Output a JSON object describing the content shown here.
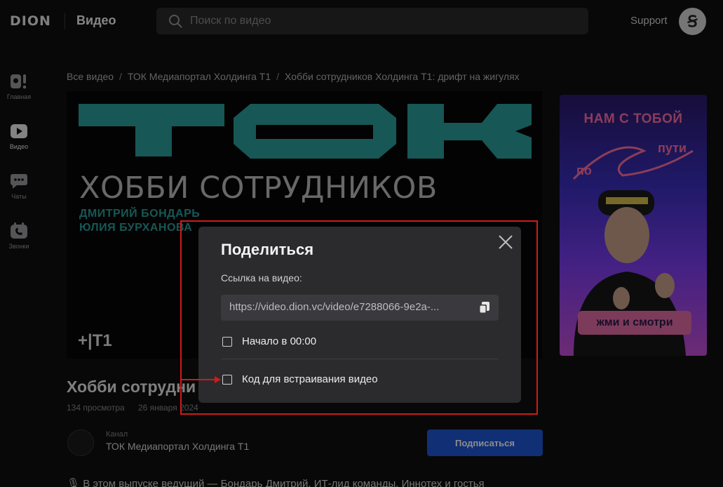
{
  "header": {
    "logo": "DION",
    "section": "Видео",
    "search_placeholder": "Поиск по видео",
    "support": "Support",
    "avatar_letter": "Ꞩ"
  },
  "nav": [
    {
      "label": "Главная",
      "icon": "home-icon"
    },
    {
      "label": "Видео",
      "icon": "video-icon",
      "active": true
    },
    {
      "label": "Чаты",
      "icon": "chat-icon"
    },
    {
      "label": "Звонки",
      "icon": "calls-icon"
    }
  ],
  "breadcrumb": {
    "items": [
      "Все видео",
      "ТОК Медиапортал Холдинга Т1",
      "Хобби сотрудников Холдинга Т1: дрифт на жигулях"
    ],
    "separator": "/"
  },
  "video": {
    "headline": "ХОББИ СОТРУДНИКОВ",
    "name_1": "ДМИТРИЙ БОНДАРЬ",
    "name_2": "ЮЛИЯ БУРХАНОВА",
    "brand": "+|T1",
    "title": "Хобби сотрудни",
    "views": "134 просмотра",
    "date": "26 января 2024"
  },
  "ad": {
    "headline": "НАМ С ТОБОЙ",
    "sub_1": "пути",
    "sub_2": "по",
    "cta": "жми и смотри"
  },
  "channel": {
    "caption": "Канал",
    "name": "ТОК Медиапортал Холдинга Т1",
    "subscribe": "Подписаться"
  },
  "description": "🎙 В этом выпуске ведущий — Бондарь Дмитрий, ИТ-лид команды, Иннотех и гостья",
  "share_modal": {
    "title": "Поделиться",
    "link_label": "Ссылка на видео:",
    "link_value": "https://video.dion.vc/video/e7288066-9e2a-...",
    "option_start": "Начало в 00:00",
    "option_embed": "Код для встраивания видео"
  },
  "colors": {
    "accent": "#1f57d6",
    "teal": "#2a9e9c",
    "highlight": "#d11a1a"
  }
}
